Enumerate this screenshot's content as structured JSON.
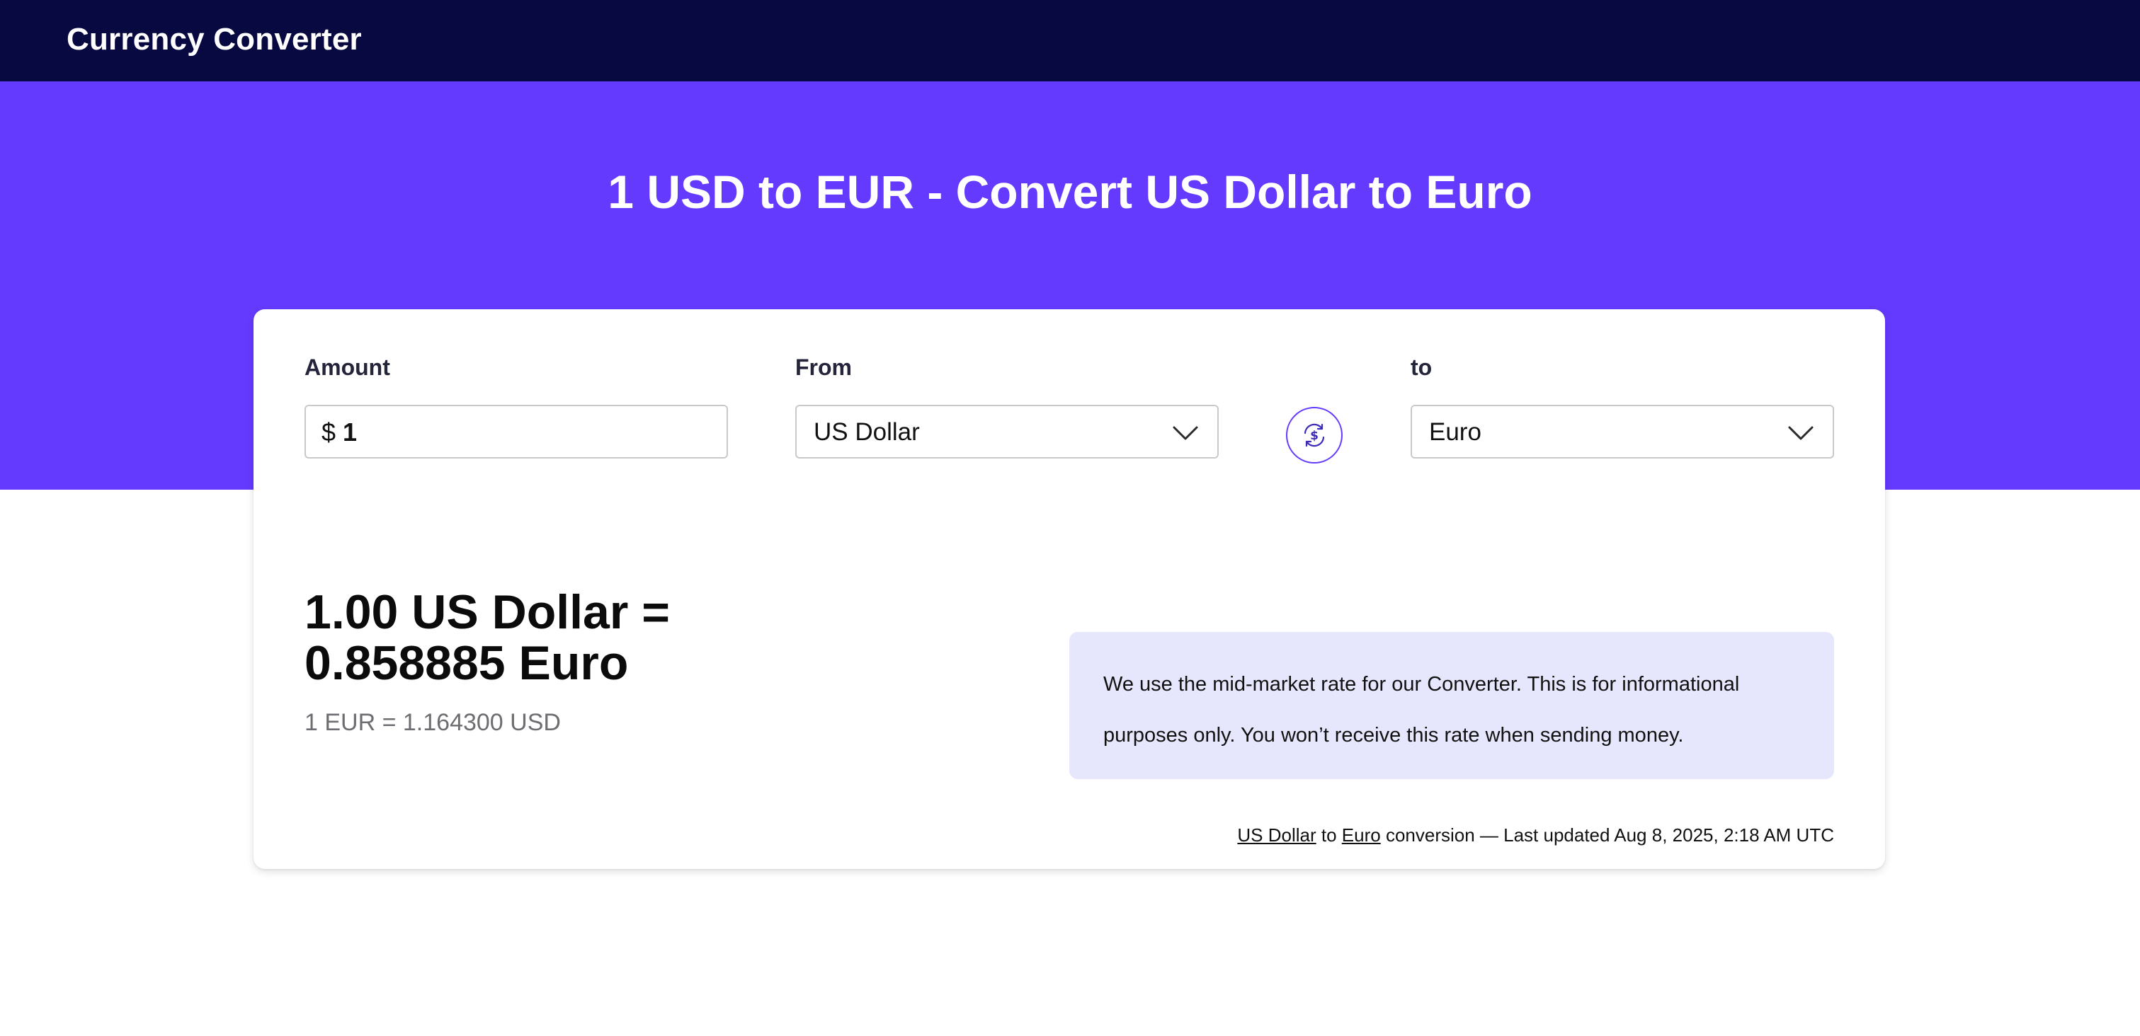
{
  "header": {
    "brand": "Currency Converter"
  },
  "hero": {
    "title": "1 USD to EUR - Convert US Dollar to Euro"
  },
  "converter": {
    "amount_label": "Amount",
    "amount_symbol": "$",
    "amount_value": "1",
    "from_label": "From",
    "from_value": "US Dollar",
    "to_label": "to",
    "to_value": "Euro",
    "swap_icon": "currency-swap-icon"
  },
  "result": {
    "line1": "1.00 US Dollar =",
    "line2": "0.858885 Euro",
    "inverse": "1 EUR = 1.164300 USD"
  },
  "info": {
    "text": "We use the mid-market rate for our Converter. This is for informational purposes only. You won’t receive this rate when sending money."
  },
  "footnote": {
    "from_link": "US Dollar",
    "connector": "to",
    "to_link": "Euro",
    "suffix": "conversion — Last updated Aug 8, 2025, 2:18 AM UTC"
  },
  "colors": {
    "nav_bg": "#080940",
    "hero_bg": "#653AFF",
    "info_bg": "#E6E6FD",
    "accent": "#653AFF"
  }
}
